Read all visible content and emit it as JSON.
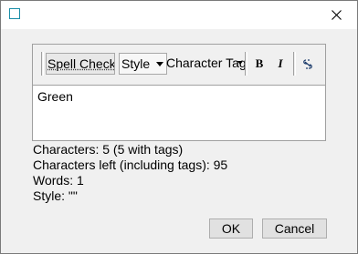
{
  "window": {
    "title": "",
    "close_icon": "close-icon"
  },
  "toolbar": {
    "spell_check_label": "Spell Check",
    "style_label": "Style",
    "character_tags_label": "Character Tag",
    "bold_label": "B",
    "italic_label": "I",
    "link_icon": "link-icon"
  },
  "editor": {
    "text": "Green"
  },
  "stats": {
    "characters": "Characters: 5 (5 with tags)",
    "characters_left": "Characters left (including tags): 95",
    "words": "Words: 1",
    "style": "Style: \"\""
  },
  "buttons": {
    "ok_label": "OK",
    "cancel_label": "Cancel"
  },
  "colors": {
    "dialog_bg": "#f0f0f0",
    "app_icon_accent": "#1b8ea8"
  }
}
